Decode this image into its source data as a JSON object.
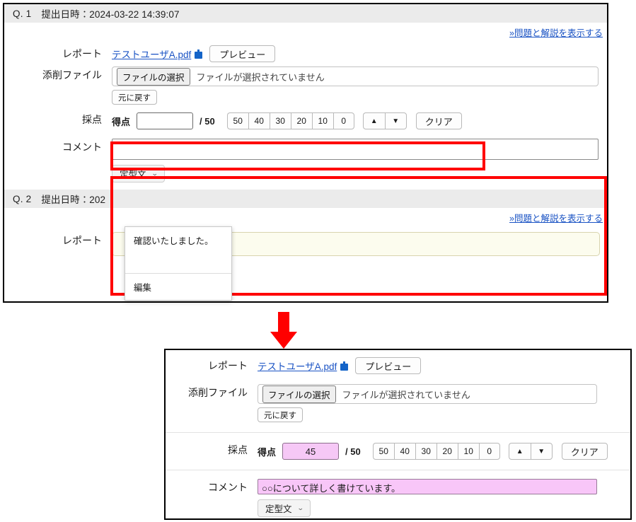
{
  "top_panel": {
    "q1": {
      "question_no": "Q. 1",
      "submitted_label": "提出日時：2024-03-22 14:39:07",
      "show_problem_link": "»問題と解説を表示する",
      "rows": {
        "report_label": "レポート",
        "report_file": "テストユーザA.pdf",
        "report_icon": "pdf-download-icon",
        "preview_button": "プレビュー",
        "correction_label": "添削ファイル",
        "file_choose_button": "ファイルの選択",
        "file_status": "ファイルが選択されていません",
        "undo_button": "元に戻す",
        "scoring_label": "採点",
        "score_label": "得点",
        "score_value": "",
        "score_max": "/ 50",
        "quick_scores": [
          "50",
          "40",
          "30",
          "20",
          "10",
          "0"
        ],
        "up_button": "▲",
        "down_button": "▼",
        "clear_button": "クリア",
        "comment_label": "コメント",
        "comment_value": "",
        "template_button": "定型文",
        "template_caret": "⌄"
      }
    },
    "q2": {
      "question_no": "Q. 2",
      "submitted_label": "提出日時：202",
      "show_problem_link": "»問題と解説を表示する",
      "report_label": "レポート"
    },
    "dropdown": {
      "items": [
        "確認いたしました。",
        "編集"
      ]
    }
  },
  "arrow": {
    "name": "red-down-arrow",
    "color": "#ff0000"
  },
  "highlights": {
    "color": "#ff0000",
    "boxes": [
      "score-row-highlight",
      "comment-area-highlight"
    ]
  },
  "bottom_panel": {
    "report_label": "レポート",
    "report_file": "テストユーザA.pdf",
    "report_icon": "pdf-download-icon",
    "preview_button": "プレビュー",
    "correction_label": "添削ファイル",
    "file_choose_button": "ファイルの選択",
    "file_status": "ファイルが選択されていません",
    "undo_button": "元に戻す",
    "scoring_label": "採点",
    "score_label": "得点",
    "score_value": "45",
    "score_max": "/ 50",
    "quick_scores": [
      "50",
      "40",
      "30",
      "20",
      "10",
      "0"
    ],
    "up_button": "▲",
    "down_button": "▼",
    "clear_button": "クリア",
    "comment_label": "コメント",
    "comment_value": "○○について詳しく書けています。",
    "template_button": "定型文",
    "template_caret": "⌄"
  },
  "colors": {
    "accent_link": "#1a53c4",
    "highlight_red": "#ff0000",
    "filled_field": "#f6c8f6",
    "header_gray": "#ebebeb",
    "q2_report_bg": "#fcfcee"
  }
}
